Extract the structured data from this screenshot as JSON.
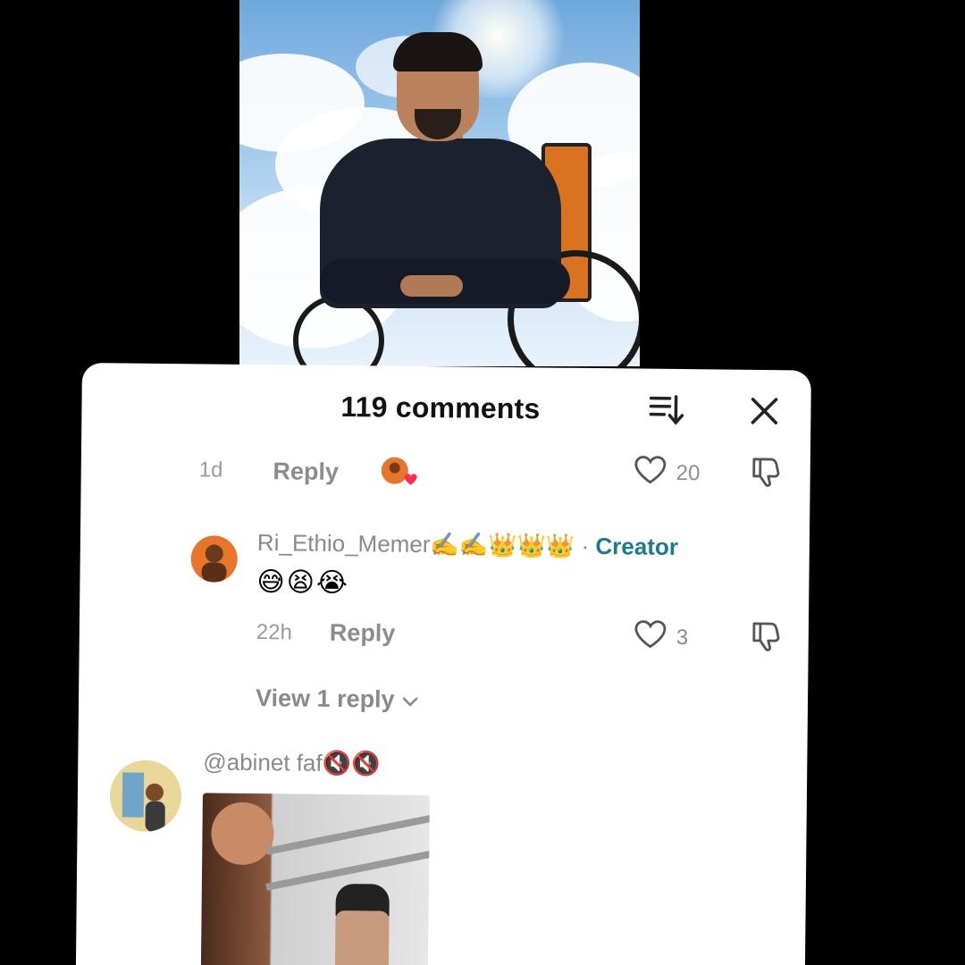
{
  "comments_panel": {
    "title": "119 comments",
    "sort_icon": "sort-icon",
    "close_icon": "close-icon"
  },
  "previous_comment": {
    "time": "1d",
    "reply_label": "Reply",
    "creator_liked_icon": "creator-liked-heart-icon",
    "like_count": "20"
  },
  "creator_comment": {
    "username": "Ri_Ethio_Memer✍️✍️👑👑👑",
    "separator": " · ",
    "creator_badge": "Creator",
    "text": "😅😫😭",
    "time": "22h",
    "reply_label": "Reply",
    "like_count": "3",
    "view_replies": "View 1 reply"
  },
  "next_comment": {
    "username": "@abinet faf🔇🔇"
  },
  "colors": {
    "creator_accent": "#1a7b8c",
    "muted_text": "#8a8a8a",
    "sheet_bg": "#ffffff",
    "page_bg": "#000000"
  }
}
